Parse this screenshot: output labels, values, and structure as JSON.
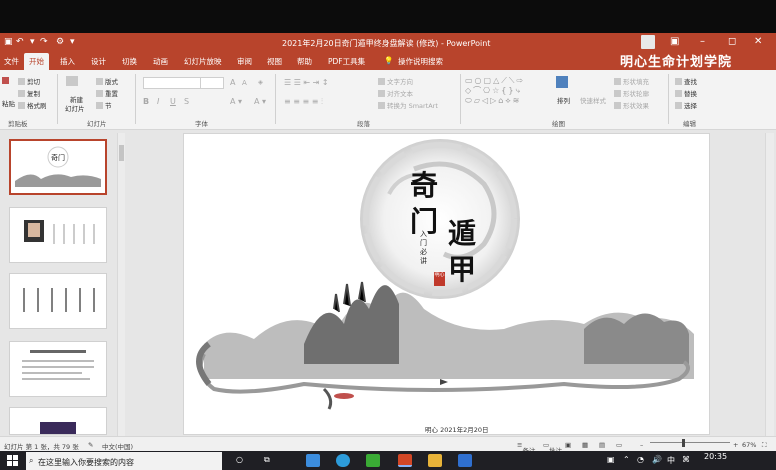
{
  "window": {
    "title": "2021年2月20日奇门遁甲终身盘解读 (修改) - PowerPoint",
    "brand_overlay": "明心生命计划学院"
  },
  "quick_access": {
    "save_icon": "save-icon",
    "undo_icon": "undo-icon",
    "redo_icon": "redo-icon"
  },
  "tabs": [
    "文件",
    "开始",
    "插入",
    "设计",
    "切换",
    "动画",
    "幻灯片放映",
    "审阅",
    "视图",
    "帮助",
    "PDF工具集",
    "操作说明搜索"
  ],
  "active_tab": "开始",
  "ribbon": {
    "clipboard": {
      "paste": "粘贴",
      "cut": "剪切",
      "copy": "复制",
      "format_painter": "格式刷",
      "group": "剪贴板"
    },
    "slides": {
      "new_slide": "新建",
      "new_slide2": "幻灯片",
      "layout": "版式",
      "reset": "重置",
      "section": "节",
      "group": "幻灯片"
    },
    "font": {
      "group": "字体",
      "bold": "B",
      "italic": "I",
      "underline": "U",
      "strike": "S",
      "grow": "A",
      "shrink": "A"
    },
    "paragraph": {
      "text_direction": "文字方向",
      "align_text": "对齐文本",
      "smartart": "转换为 SmartArt",
      "group": "段落"
    },
    "drawing": {
      "arrange": "排列",
      "quick_styles": "快速样式",
      "shape_fill": "形状填充",
      "shape_outline": "形状轮廓",
      "shape_effects": "形状效果",
      "group": "绘图"
    },
    "editing": {
      "find": "查找",
      "replace": "替换",
      "select": "选择",
      "group": "编辑"
    }
  },
  "slide": {
    "title_chars": [
      "奇",
      "门",
      "遁",
      "甲"
    ],
    "subtitle": "入门必讲",
    "seal": "明心",
    "footer_date": "明心 2021年2月20日"
  },
  "status": {
    "slide_info": "幻灯片 第 1 张，共 79 张",
    "language": "中文(中国)",
    "notes": "备注",
    "comments": "批注",
    "zoom": "67%"
  },
  "taskbar": {
    "search_placeholder": "在这里输入你要搜索的内容",
    "time": "20:35",
    "ime": "中"
  },
  "colors": {
    "accent": "#b8442c",
    "taskbar": "#1f1f24"
  }
}
